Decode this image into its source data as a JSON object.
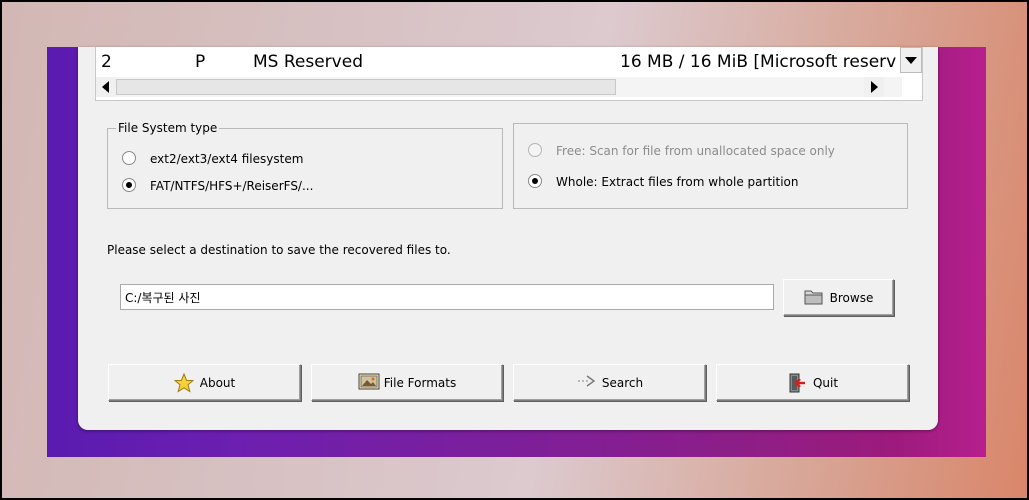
{
  "partition_list": {
    "row": {
      "number": "2",
      "flag": "P",
      "name": "MS Reserved",
      "size": "16 MB / 16 MiB [Microsoft reserv"
    }
  },
  "filesystem_group": {
    "title": "File System type",
    "options": [
      {
        "label": "ext2/ext3/ext4 filesystem",
        "checked": false
      },
      {
        "label": "FAT/NTFS/HFS+/ReiserFS/...",
        "checked": true
      }
    ]
  },
  "scan_group": {
    "options": [
      {
        "label": "Free: Scan for file from unallocated space only",
        "checked": false,
        "enabled": false
      },
      {
        "label": "Whole: Extract files from whole partition",
        "checked": true,
        "enabled": true
      }
    ]
  },
  "destination": {
    "prompt": "Please select a destination to save the recovered files to.",
    "path": "C:/복구된 사진",
    "browse_label": "Browse"
  },
  "buttons": {
    "about": "About",
    "file_formats": "File Formats",
    "search": "Search",
    "quit": "Quit"
  }
}
